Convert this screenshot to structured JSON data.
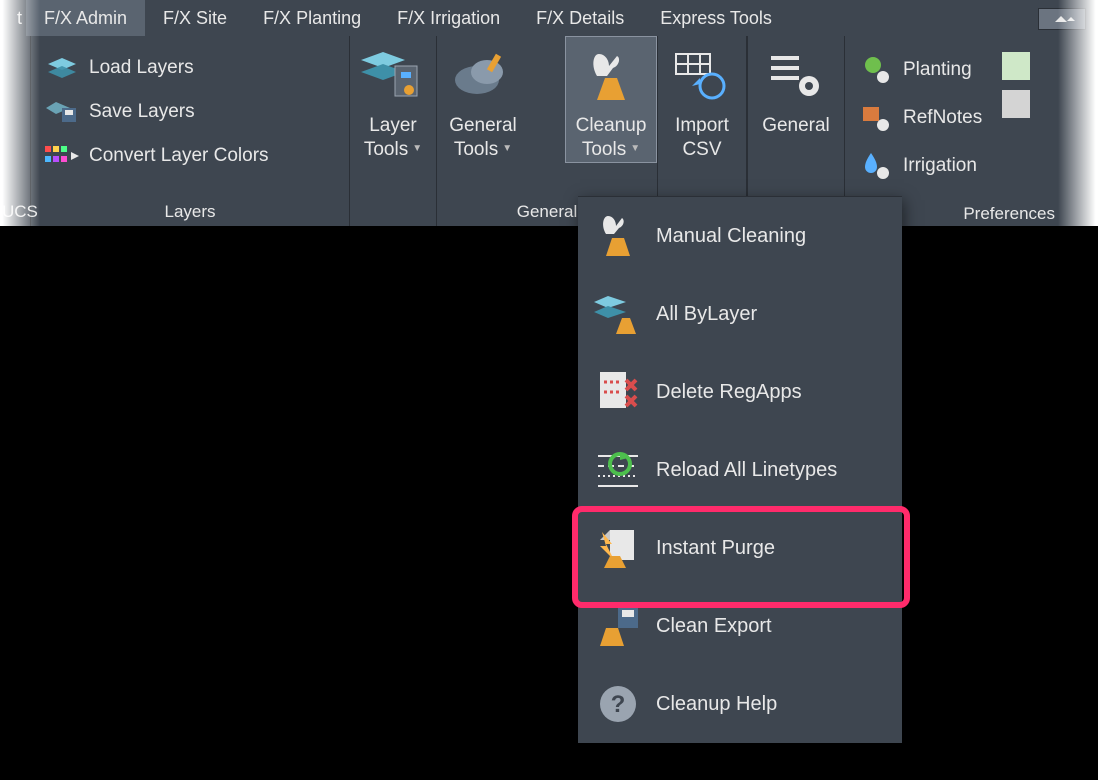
{
  "tabs": {
    "leftFragment": "t",
    "items": [
      "F/X Admin",
      "F/X Site",
      "F/X Planting",
      "F/X Irrigation",
      "F/X Details",
      "Express Tools"
    ],
    "activeIndex": 0
  },
  "panels": {
    "ucsTitle": "UCS",
    "layers": {
      "title": "Layers",
      "items": [
        "Load Layers",
        "Save Layers",
        "Convert Layer Colors"
      ]
    },
    "layerTools": {
      "label_l1": "Layer",
      "label_l2": "Tools"
    },
    "generalGroup": {
      "title": "General",
      "generalTools": {
        "label_l1": "General",
        "label_l2": "Tools"
      },
      "cleanupTools": {
        "label_l1": "Cleanup",
        "label_l2": "Tools"
      }
    },
    "importCsv": {
      "label_l1": "Import",
      "label_l2": "CSV"
    },
    "generalBtn": {
      "label": "General"
    },
    "preferences": {
      "title": "Preferences",
      "items": [
        "Planting",
        "RefNotes",
        "Irrigation"
      ]
    }
  },
  "dropdown": {
    "items": [
      "Manual Cleaning",
      "All ByLayer",
      "Delete RegApps",
      "Reload All Linetypes",
      "Instant Purge",
      "Clean Export",
      "Cleanup Help"
    ],
    "highlightedIndex": 4
  }
}
